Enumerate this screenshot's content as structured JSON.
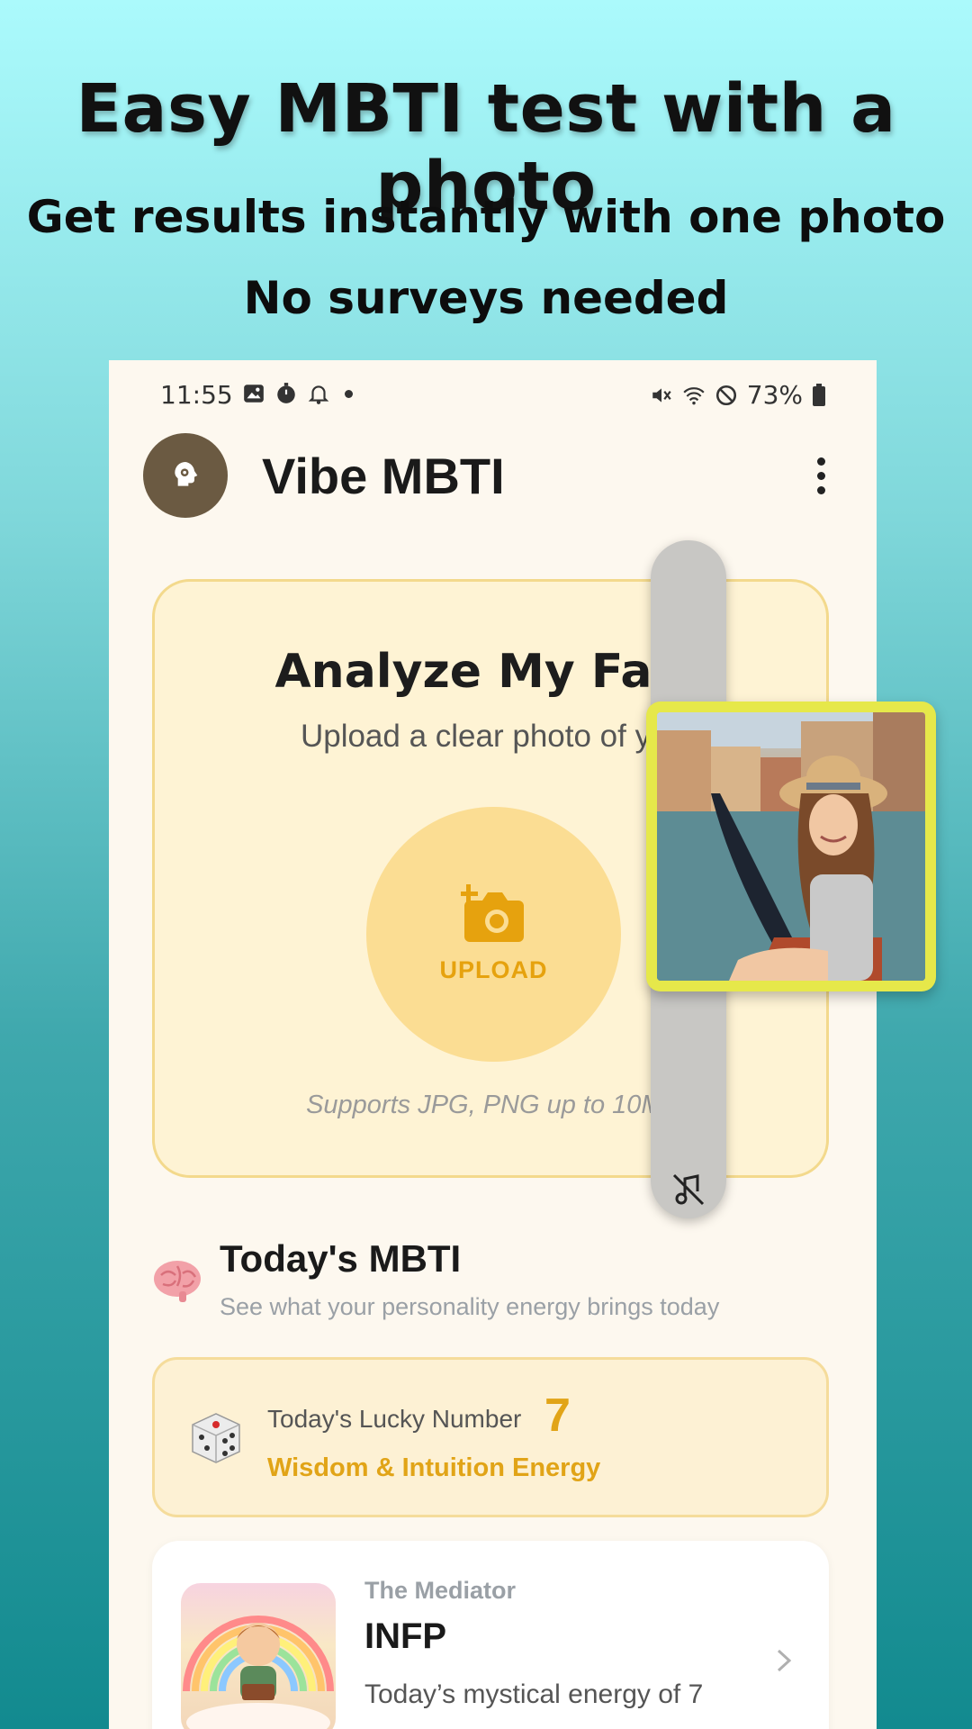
{
  "promo": {
    "headline": "Easy MBTI test with a photo",
    "sub1": "Get results instantly with one photo",
    "sub2": "No surveys needed"
  },
  "status_bar": {
    "time": "11:55",
    "battery": "73%"
  },
  "app": {
    "title": "Vibe MBTI"
  },
  "analyze": {
    "title": "Analyze My Face",
    "subtitle": "Upload a clear photo of you",
    "upload_label": "UPLOAD",
    "note": "Supports JPG, PNG up to 10MB"
  },
  "today": {
    "title": "Today's MBTI",
    "subtitle": "See what your personality energy brings today"
  },
  "lucky": {
    "label": "Today's Lucky Number",
    "number": "7",
    "energy": "Wisdom & Intuition Energy"
  },
  "mbti_card": {
    "nickname": "The Mediator",
    "type": "INFP",
    "description": "Today’s mystical energy of 7"
  },
  "colors": {
    "accent": "#e1a417",
    "upload_circle": "#fbdd93",
    "card_bg": "#fef3d4",
    "logo_bg": "#6b5a42",
    "photo_frame": "#e6e84a"
  },
  "icons": [
    "gallery-icon",
    "timer-icon",
    "bell-icon",
    "mute-icon",
    "wifi-icon",
    "block-icon",
    "battery-icon",
    "brain-settings-icon",
    "more-vert-icon",
    "add-photo-icon",
    "music-off-icon",
    "brain-icon",
    "dice-icon",
    "chevron-right-icon"
  ]
}
